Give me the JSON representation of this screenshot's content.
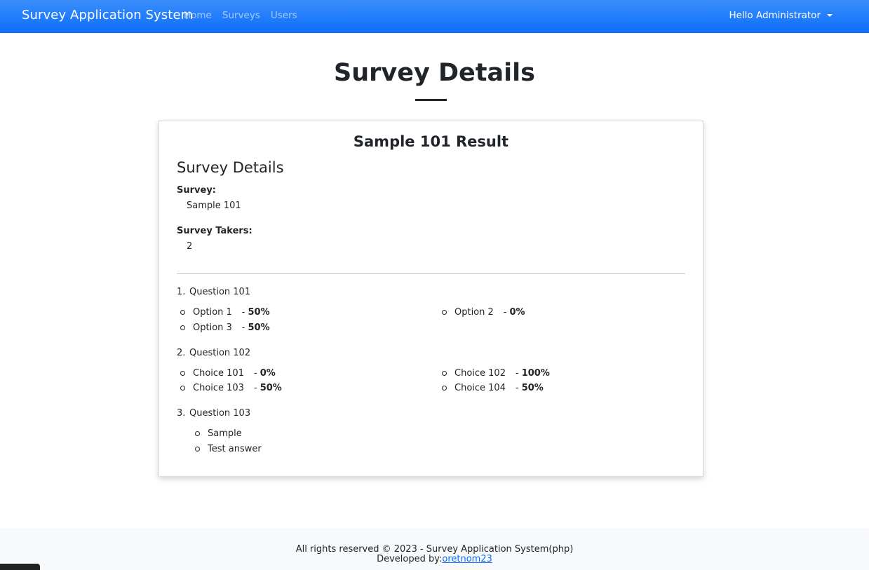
{
  "navbar": {
    "brand": "Survey Application System",
    "links": [
      "Home",
      "Surveys",
      "Users"
    ],
    "user_menu": "Hello Administrator"
  },
  "page": {
    "title": "Survey Details"
  },
  "card": {
    "title": "Sample 101 Result",
    "section_heading": "Survey Details",
    "survey_label": "Survey:",
    "survey_value": "Sample 101",
    "takers_label": "Survey Takers:",
    "takers_value": "2"
  },
  "questions": [
    {
      "number": "1.",
      "text": "Question 101",
      "options": [
        {
          "label": "Option 1",
          "percent": "50%"
        },
        {
          "label": "Option 2",
          "percent": "0%"
        },
        {
          "label": "Option 3",
          "percent": "50%"
        }
      ]
    },
    {
      "number": "2.",
      "text": "Question 102",
      "options": [
        {
          "label": "Choice 101",
          "percent": "0%"
        },
        {
          "label": "Choice 102",
          "percent": "100%"
        },
        {
          "label": "Choice 103",
          "percent": "50%"
        },
        {
          "label": "Choice 104",
          "percent": "50%"
        }
      ]
    },
    {
      "number": "3.",
      "text": "Question 103",
      "answers": [
        "Sample",
        "Test answer"
      ]
    }
  ],
  "footer": {
    "rights": "All rights reserved © 2023 - Survey Application System(php)",
    "developed_by": "Developed by:",
    "developer_link": "oretnom23"
  }
}
